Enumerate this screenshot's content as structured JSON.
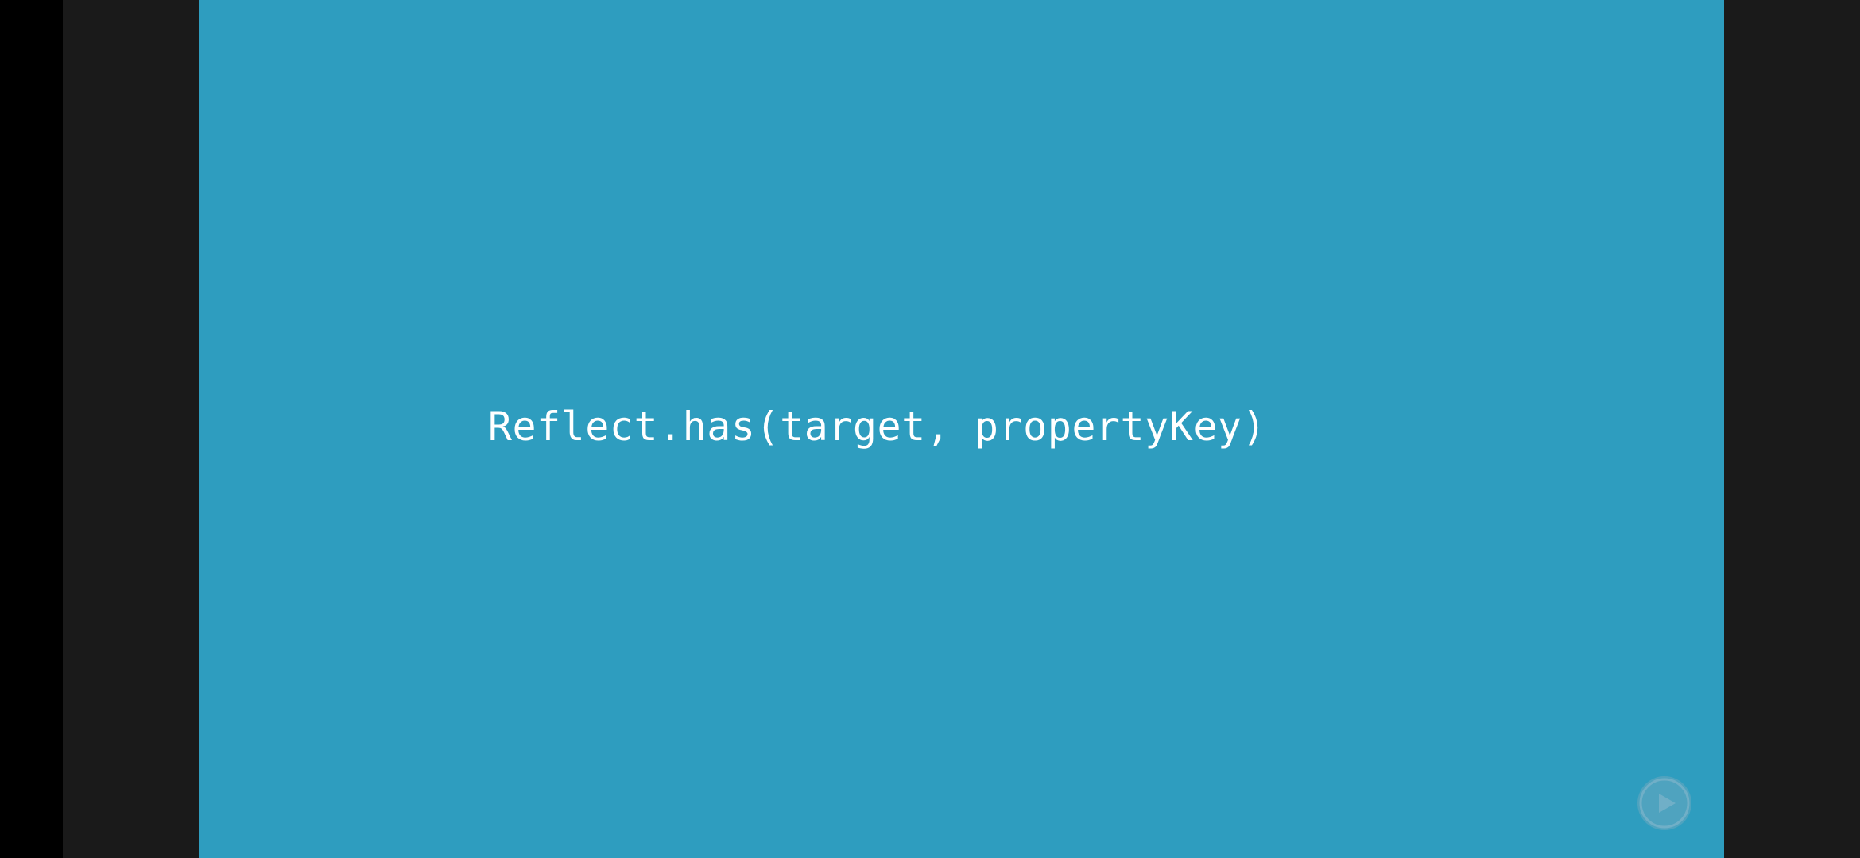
{
  "slide": {
    "code_text": "Reflect.has(target, propertyKey)"
  },
  "controls": {
    "play_icon": "play-icon"
  },
  "colors": {
    "slide_background": "#2e9dbf",
    "letterbox": "#1a1a1a",
    "text": "#ffffff"
  }
}
